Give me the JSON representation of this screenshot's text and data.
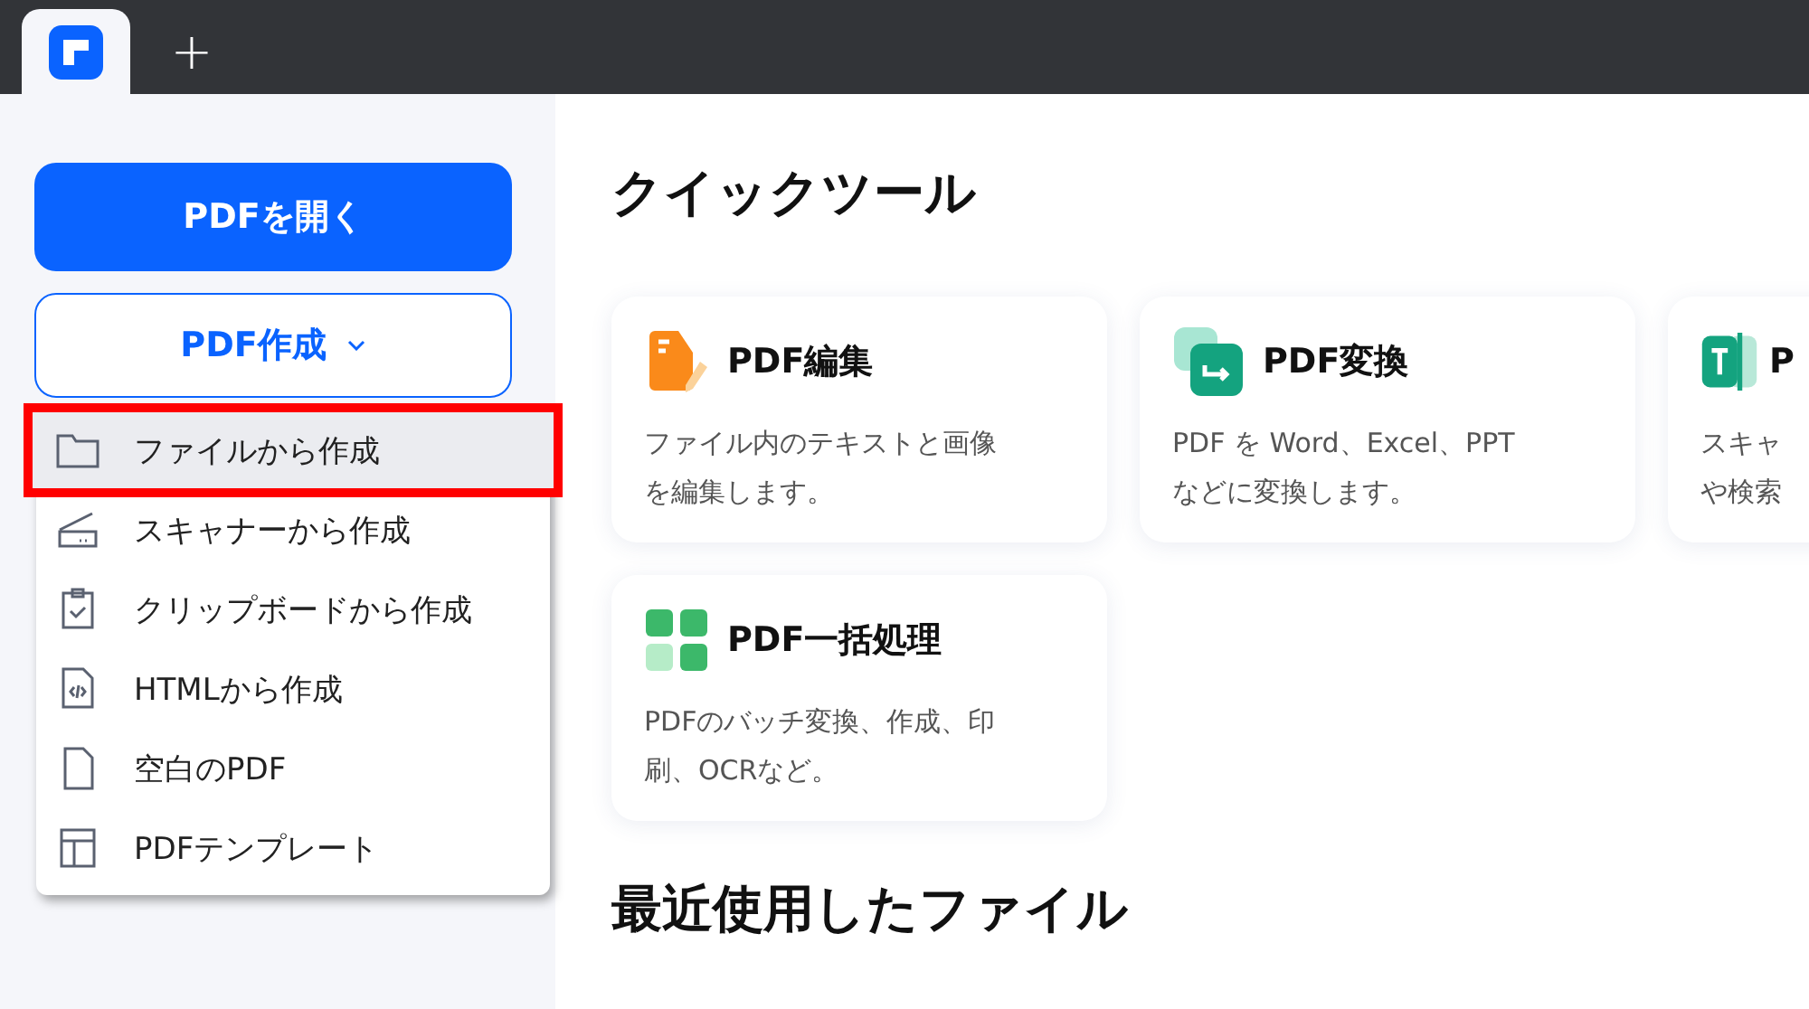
{
  "tabbar": {
    "new_tab": "+"
  },
  "sidebar": {
    "open_button": "PDFを開く",
    "create_button": {
      "label": "PDF作成",
      "expanded": true
    }
  },
  "create_menu": [
    {
      "label": "ファイルから作成",
      "selected": true,
      "highlighted": true
    },
    {
      "label": "スキャナーから作成",
      "selected": false,
      "highlighted": false
    },
    {
      "label": "クリップボードから作成",
      "selected": false,
      "highlighted": false
    },
    {
      "label": "HTMLから作成",
      "selected": false,
      "highlighted": false
    },
    {
      "label": "空白のPDF",
      "selected": false,
      "highlighted": false
    },
    {
      "label": "PDFテンプレート",
      "selected": false,
      "highlighted": false
    }
  ],
  "main": {
    "title": "クイックツール",
    "tools": [
      {
        "title": "PDF編集",
        "description": "ファイル内のテキストと画像を編集します。"
      },
      {
        "title": "PDF変換",
        "description": "PDF を Word、Excel、PPT などに変換します。"
      },
      {
        "title": "P",
        "description": "スキャや検索"
      },
      {
        "title": "PDF一括処理",
        "description": "PDFのバッチ変換、作成、印刷、OCRなど。"
      }
    ],
    "recent_title": "最近使用したファイル"
  }
}
